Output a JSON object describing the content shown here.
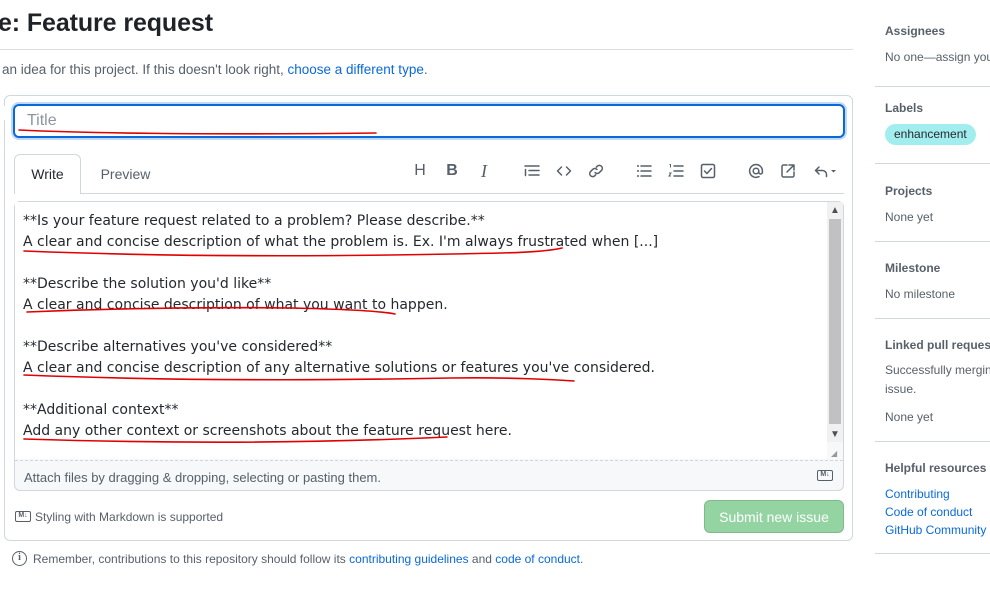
{
  "header": {
    "title": "e: Feature request",
    "subtitle_prefix": "an idea for this project. If this doesn't look right, ",
    "subtitle_link": "choose a different type",
    "subtitle_suffix": "."
  },
  "form": {
    "title_placeholder": "Title",
    "tabs": [
      "Write",
      "Preview"
    ],
    "toolbar_icons": [
      "heading-icon",
      "bold-icon",
      "italic-icon",
      "quote-icon",
      "code-icon",
      "link-icon",
      "bulleted-list-icon",
      "numbered-list-icon",
      "task-list-icon",
      "mention-icon",
      "reference-icon",
      "undo-icon"
    ],
    "body_lines": [
      "**Is your feature request related to a problem? Please describe.**",
      "A clear and concise description of what the problem is. Ex. I'm always frustrated when [...]",
      "",
      "**Describe the solution you'd like**",
      "A clear and concise description of what you want to happen.",
      "",
      "**Describe alternatives you've considered**",
      "A clear and concise description of any alternative solutions or features you've considered.",
      "",
      "**Additional context**",
      "Add any other context or screenshots about the feature request here."
    ],
    "attach_hint": "Attach files by dragging & dropping, selecting or pasting them.",
    "markdown_note": "Styling with Markdown is supported",
    "submit_label": "Submit new issue",
    "md_badge": "M↓"
  },
  "notice": {
    "prefix": "Remember, contributions to this repository should follow its ",
    "link1": "contributing guidelines",
    "middle": " and ",
    "link2": "code of conduct",
    "suffix": "."
  },
  "sidebar": {
    "assignees_heading": "Assignees",
    "assignees_value": "No one—assign you",
    "labels_heading": "Labels",
    "label_pill": "enhancement",
    "label_color": "#a2eeef",
    "projects_heading": "Projects",
    "projects_value": "None yet",
    "milestone_heading": "Milestone",
    "milestone_value": "No milestone",
    "linked_heading": "Linked pull requests",
    "linked_line1": "Successfully mergin",
    "linked_line2": "issue.",
    "linked_value": "None yet",
    "resources_heading": "Helpful resources",
    "resources": [
      "Contributing",
      "Code of conduct",
      "GitHub Community"
    ]
  },
  "colors": {
    "accent": "#0969da",
    "submit_disabled": "#94d3a2",
    "annotation": "#e00000"
  }
}
